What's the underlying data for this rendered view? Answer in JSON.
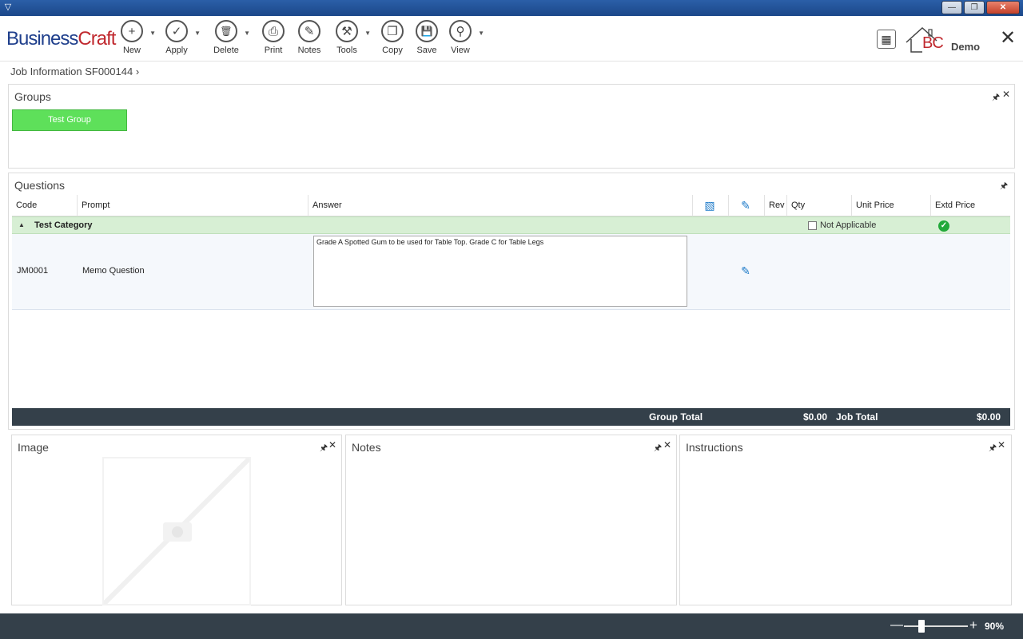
{
  "window": {
    "icon": "app-icon",
    "buttons": [
      "minimize",
      "restore",
      "close"
    ]
  },
  "toolbar": {
    "logo_business": "Business",
    "logo_craft": "Craft",
    "buttons": [
      {
        "label": "New",
        "icon": "plus-icon",
        "glyph": "+"
      },
      {
        "label": "Apply",
        "icon": "check-icon",
        "glyph": "✓"
      },
      {
        "label": "Delete",
        "icon": "trash-icon",
        "glyph": "🗑"
      },
      {
        "label": "Print",
        "icon": "printer-icon",
        "glyph": "⎙"
      },
      {
        "label": "Notes",
        "icon": "notes-icon",
        "glyph": "✎"
      },
      {
        "label": "Tools",
        "icon": "tools-icon",
        "glyph": "⚒"
      },
      {
        "label": "Copy",
        "icon": "copy-icon",
        "glyph": "❐"
      },
      {
        "label": "Save",
        "icon": "save-icon",
        "glyph": "💾"
      },
      {
        "label": "View",
        "icon": "magnifier-icon",
        "glyph": "⚲"
      }
    ],
    "bc_logo": "BC",
    "demo": "Demo"
  },
  "breadcrumb": "Job Information SF000144 ›",
  "groups": {
    "title": "Groups",
    "items": [
      "Test Group"
    ]
  },
  "questions": {
    "title": "Questions",
    "columns": [
      "Code",
      "Prompt",
      "Answer",
      "",
      "",
      "Rev",
      "Qty",
      "Unit Price",
      "Extd Price"
    ],
    "category": "Test Category",
    "not_applicable": "Not Applicable",
    "rows": [
      {
        "code": "JM0001",
        "prompt": "Memo Question",
        "answer": "Grade A Spotted Gum to be used for Table Top. Grade C for Table Legs"
      }
    ],
    "group_total_label": "Group Total",
    "group_total": "$0.00",
    "job_total_label": "Job Total",
    "job_total": "$0.00"
  },
  "bottom_panels": {
    "image": "Image",
    "notes": "Notes",
    "instructions": "Instructions"
  },
  "status": {
    "zoom": "90%"
  },
  "colors": {
    "accent_green": "#5ee05a",
    "dark_bar": "#34404a",
    "category_bg": "#d7efd4"
  }
}
